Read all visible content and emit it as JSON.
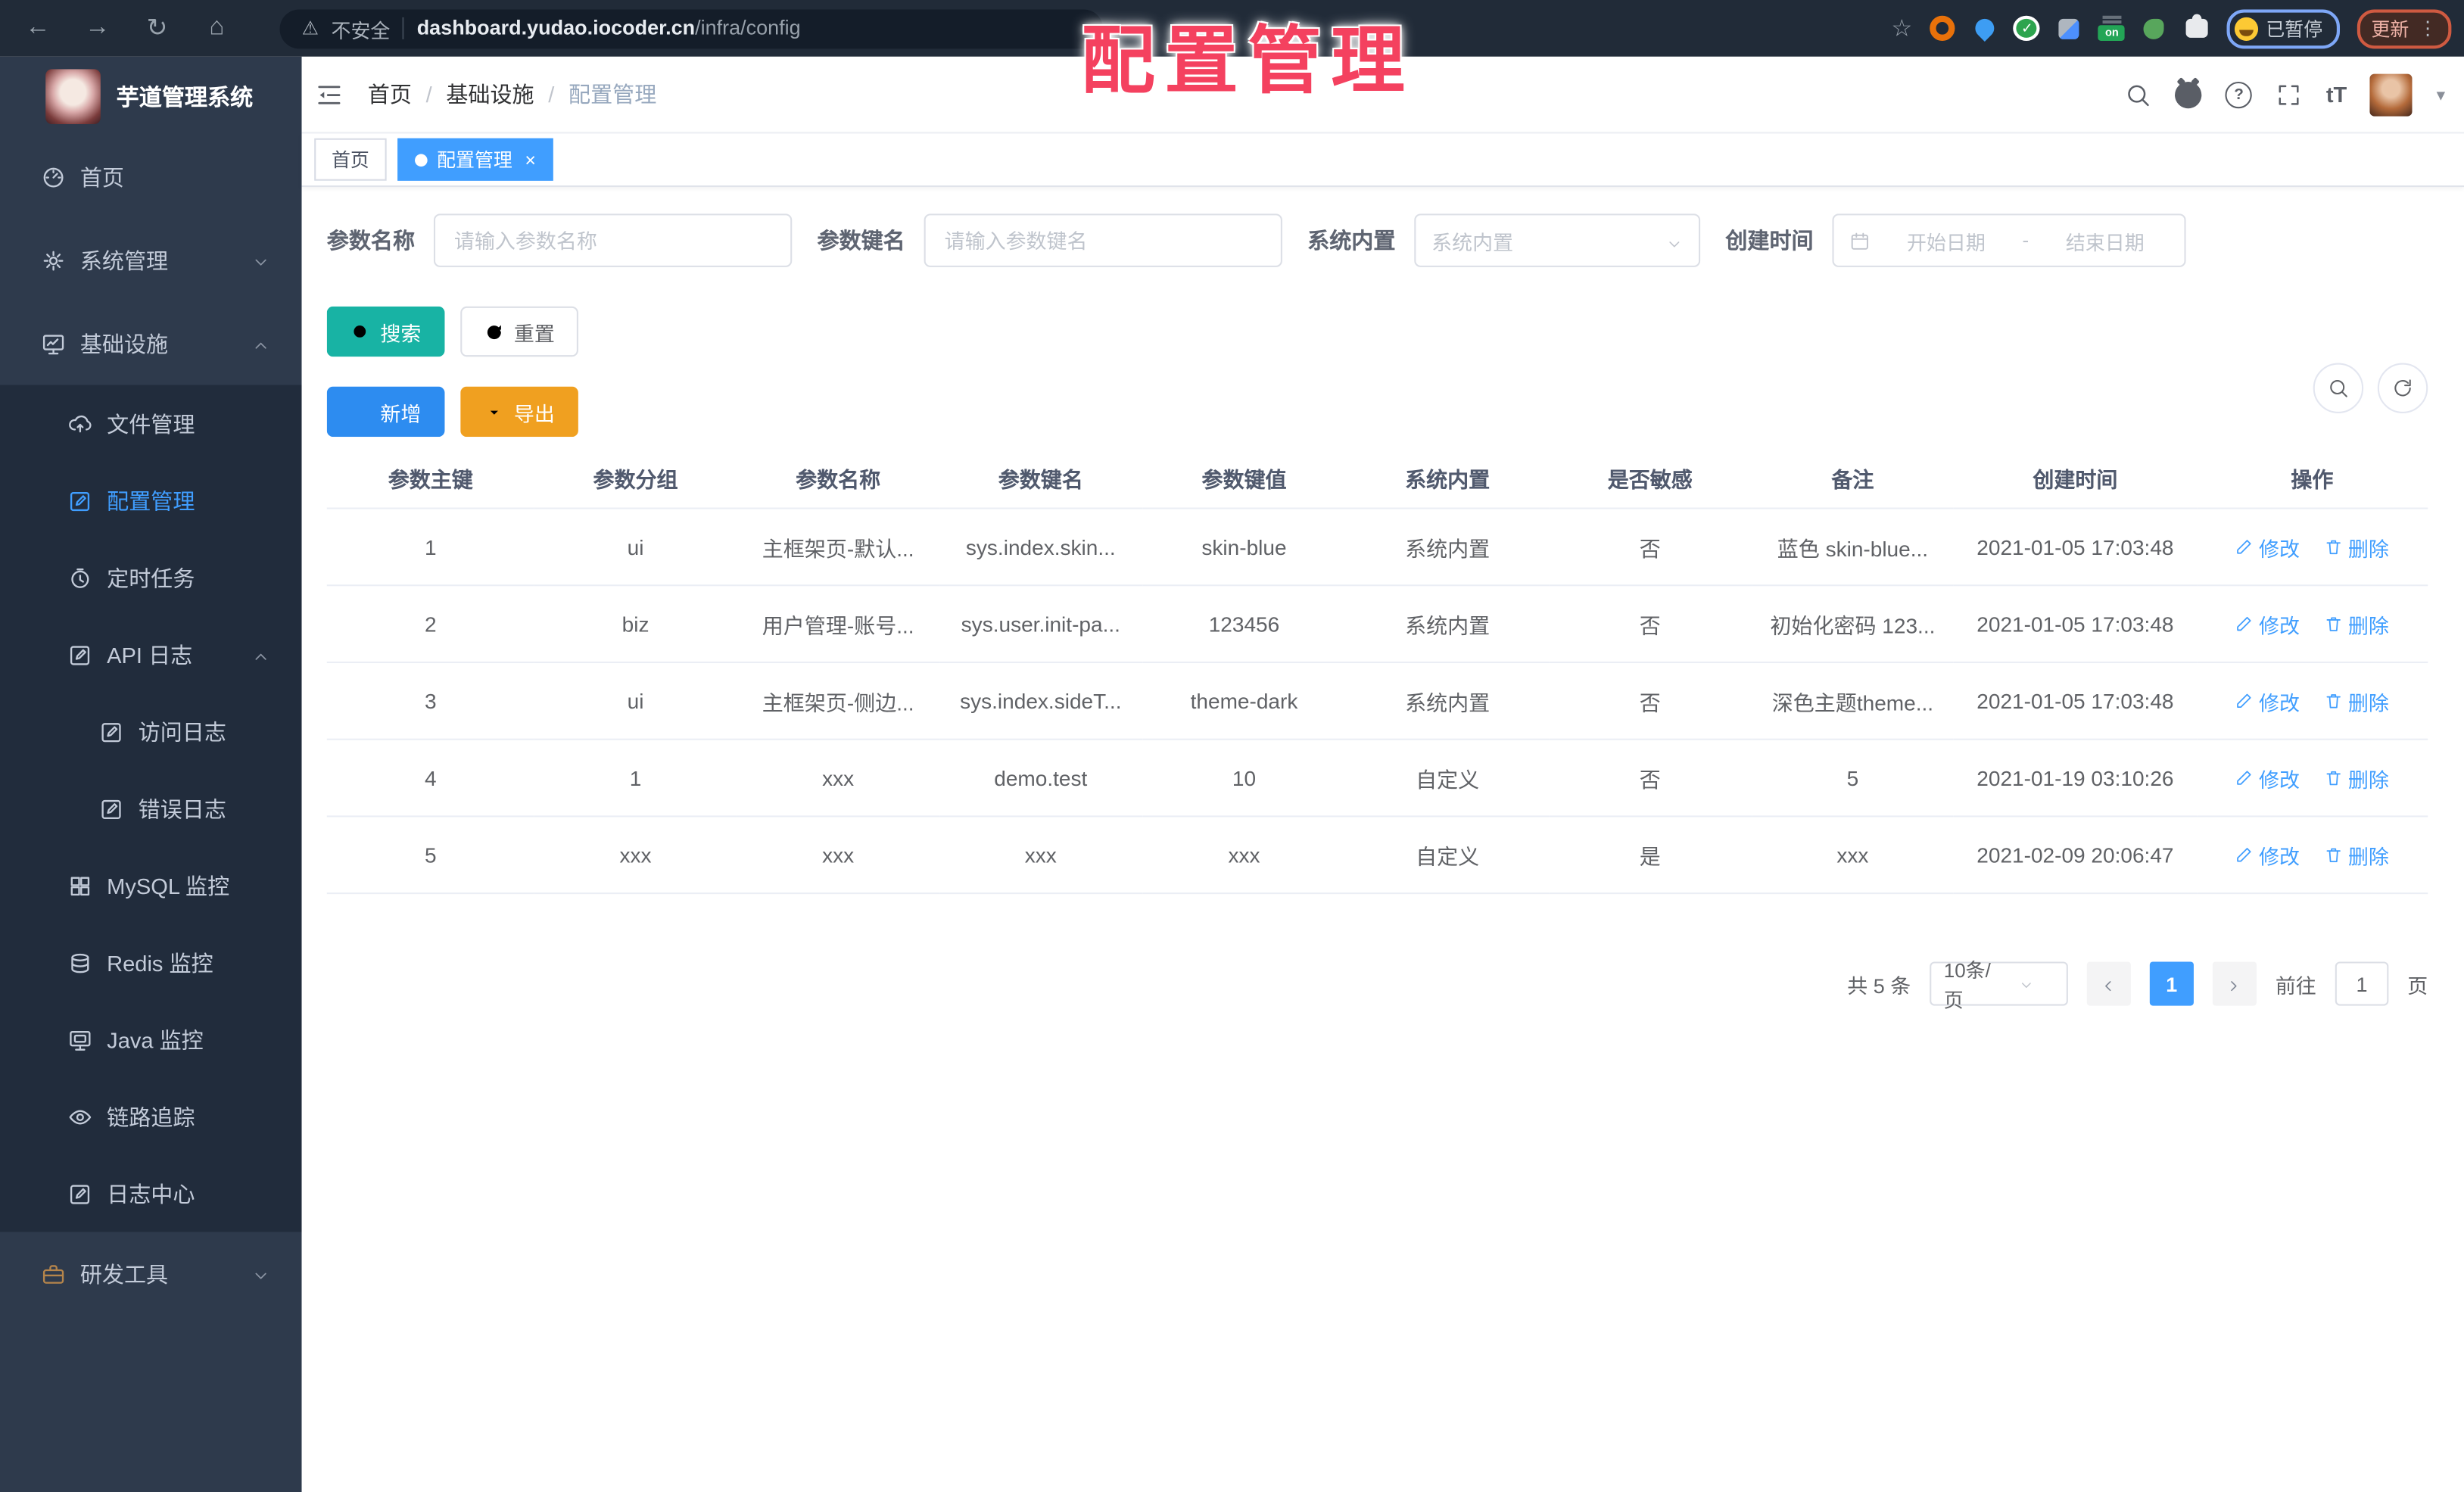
{
  "annotation_title": "配置管理",
  "browser": {
    "insecure_label": "不安全",
    "url_host": "dashboard.yudao.iocoder.cn",
    "url_path": "/infra/config",
    "extension_badge": "on",
    "paused_label": "已暂停",
    "update_label": "更新",
    "icons": [
      "back-icon",
      "forward-icon",
      "reload-icon",
      "home-icon",
      "bookmark-star-icon",
      "extensions-icon"
    ]
  },
  "sidebar": {
    "app_title": "芋道管理系统",
    "items": [
      {
        "label": "首页",
        "icon": "dashboard-icon"
      },
      {
        "label": "系统管理",
        "icon": "gear-icon",
        "chevron": "down"
      },
      {
        "label": "基础设施",
        "icon": "infra-monitor-icon",
        "chevron": "up"
      },
      {
        "label": "文件管理",
        "icon": "cloud-upload-icon"
      },
      {
        "label": "配置管理",
        "icon": "edit-square-icon",
        "active": true
      },
      {
        "label": "定时任务",
        "icon": "timer-icon"
      },
      {
        "label": "API 日志",
        "icon": "log-edit-icon",
        "chevron": "up"
      },
      {
        "label": "访问日志",
        "icon": "log-edit-icon"
      },
      {
        "label": "错误日志",
        "icon": "log-edit-icon"
      },
      {
        "label": "MySQL 监控",
        "icon": "grid-icon"
      },
      {
        "label": "Redis 监控",
        "icon": "database-icon"
      },
      {
        "label": "Java 监控",
        "icon": "monitor-icon"
      },
      {
        "label": "链路追踪",
        "icon": "eye-icon"
      },
      {
        "label": "日志中心",
        "icon": "log-edit-icon"
      },
      {
        "label": "研发工具",
        "icon": "briefcase-icon",
        "chevron": "down"
      }
    ]
  },
  "navbar": {
    "breadcrumb": [
      "首页",
      "基础设施",
      "配置管理"
    ],
    "icons": [
      "search-icon",
      "github-icon",
      "help-icon",
      "fullscreen-icon",
      "font-size-icon"
    ],
    "font_size_label": "tT"
  },
  "tags": {
    "home": "首页",
    "active": "配置管理",
    "close": "×"
  },
  "filters": {
    "name_label": "参数名称",
    "name_placeholder": "请输入参数名称",
    "key_label": "参数键名",
    "key_placeholder": "请输入参数键名",
    "builtin_label": "系统内置",
    "builtin_placeholder": "系统内置",
    "time_label": "创建时间",
    "start_placeholder": "开始日期",
    "range_separator": "-",
    "end_placeholder": "结束日期"
  },
  "toolbar": {
    "search": "搜索",
    "reset": "重置",
    "add": "新增",
    "export": "导出"
  },
  "table": {
    "headers": [
      "参数主键",
      "参数分组",
      "参数名称",
      "参数键名",
      "参数键值",
      "系统内置",
      "是否敏感",
      "备注",
      "创建时间",
      "操作"
    ],
    "edit_label": "修改",
    "delete_label": "删除",
    "rows": [
      {
        "id": "1",
        "group": "ui",
        "name": "主框架页-默认...",
        "key": "sys.index.skin...",
        "value": "skin-blue",
        "builtin": "系统内置",
        "sensitive": "否",
        "remark": "蓝色 skin-blue...",
        "time": "2021-01-05 17:03:48"
      },
      {
        "id": "2",
        "group": "biz",
        "name": "用户管理-账号...",
        "key": "sys.user.init-pa...",
        "value": "123456",
        "builtin": "系统内置",
        "sensitive": "否",
        "remark": "初始化密码 123...",
        "time": "2021-01-05 17:03:48"
      },
      {
        "id": "3",
        "group": "ui",
        "name": "主框架页-侧边...",
        "key": "sys.index.sideT...",
        "value": "theme-dark",
        "builtin": "系统内置",
        "sensitive": "否",
        "remark": "深色主题theme...",
        "time": "2021-01-05 17:03:48"
      },
      {
        "id": "4",
        "group": "1",
        "name": "xxx",
        "key": "demo.test",
        "value": "10",
        "builtin": "自定义",
        "sensitive": "否",
        "remark": "5",
        "time": "2021-01-19 03:10:26"
      },
      {
        "id": "5",
        "group": "xxx",
        "name": "xxx",
        "key": "xxx",
        "value": "xxx",
        "builtin": "自定义",
        "sensitive": "是",
        "remark": "xxx",
        "time": "2021-02-09 20:06:47"
      }
    ]
  },
  "pagination": {
    "total": "共 5 条",
    "page_size": "10条/页",
    "current": "1",
    "goto": "前往",
    "goto_value": "1",
    "page_unit": "页"
  }
}
